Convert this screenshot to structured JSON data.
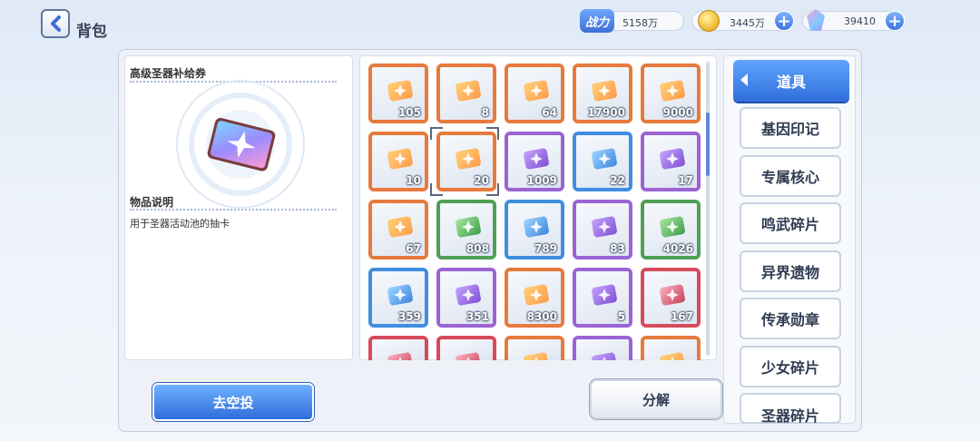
{
  "header": {
    "title": "背包"
  },
  "resources": {
    "power": {
      "label": "战力",
      "value": "5158万"
    },
    "coins": {
      "value": "3445万"
    },
    "crystals": {
      "value": "39410"
    }
  },
  "detail": {
    "item_name": "高级圣器补给券",
    "desc_heading": "物品说明",
    "description": "用于圣器活动池的抽卡"
  },
  "items": [
    {
      "qty": "105",
      "quality": "orange",
      "icon": "rainbow-ticket-icon"
    },
    {
      "qty": "8",
      "quality": "orange",
      "icon": "gold-ticket-icon"
    },
    {
      "qty": "64",
      "quality": "orange",
      "icon": "purple-ticket-icon"
    },
    {
      "qty": "17900",
      "quality": "orange",
      "icon": "dust-icon"
    },
    {
      "qty": "9000",
      "quality": "orange",
      "icon": "rainbow-crystal-icon"
    },
    {
      "qty": "10",
      "quality": "orange",
      "icon": "gold-card-icon"
    },
    {
      "qty": "20",
      "quality": "orange",
      "icon": "purple-card-icon"
    },
    {
      "qty": "1009",
      "quality": "purple",
      "icon": "green-vial-icon"
    },
    {
      "qty": "22",
      "quality": "blue",
      "icon": "candy-icon"
    },
    {
      "qty": "17",
      "quality": "purple",
      "icon": "canister-icon"
    },
    {
      "qty": "67",
      "quality": "orange",
      "icon": "bag-icon"
    },
    {
      "qty": "808",
      "quality": "green",
      "icon": "blue-chip-icon"
    },
    {
      "qty": "789",
      "quality": "blue",
      "icon": "purple-chip-icon"
    },
    {
      "qty": "83",
      "quality": "purple",
      "icon": "orange-chip-icon"
    },
    {
      "qty": "4026",
      "quality": "green",
      "icon": "ice-crystal-icon"
    },
    {
      "qty": "359",
      "quality": "blue",
      "icon": "blue-star-shard-icon"
    },
    {
      "qty": "351",
      "quality": "purple",
      "icon": "purple-star-shard-icon"
    },
    {
      "qty": "8300",
      "quality": "orange",
      "icon": "brain-coral-icon"
    },
    {
      "qty": "5",
      "quality": "purple",
      "icon": "device-icon"
    },
    {
      "qty": "167",
      "quality": "red",
      "icon": "gem-icon"
    },
    {
      "qty": "",
      "quality": "red",
      "icon": "item-icon"
    },
    {
      "qty": "",
      "quality": "red",
      "icon": "item-icon"
    },
    {
      "qty": "",
      "quality": "orange",
      "icon": "item-icon"
    },
    {
      "qty": "",
      "quality": "purple",
      "icon": "item-icon"
    },
    {
      "qty": "",
      "quality": "orange",
      "icon": "item-icon"
    }
  ],
  "selected_index": 6,
  "tabs": [
    "道具",
    "基因印记",
    "专属核心",
    "鸣武碎片",
    "异界遗物",
    "传承勋章",
    "少女碎片",
    "圣器碎片"
  ],
  "active_tab": 0,
  "buttons": {
    "airdrop": "去空投",
    "decompose": "分解"
  },
  "colors": {
    "orange": "#e77a3d",
    "gold": "#e6a23a",
    "purple": "#9b63d4",
    "blue": "#3f8ee0",
    "green": "#4fa055",
    "red": "#d64b5b",
    "accent": "#2f6edb"
  }
}
